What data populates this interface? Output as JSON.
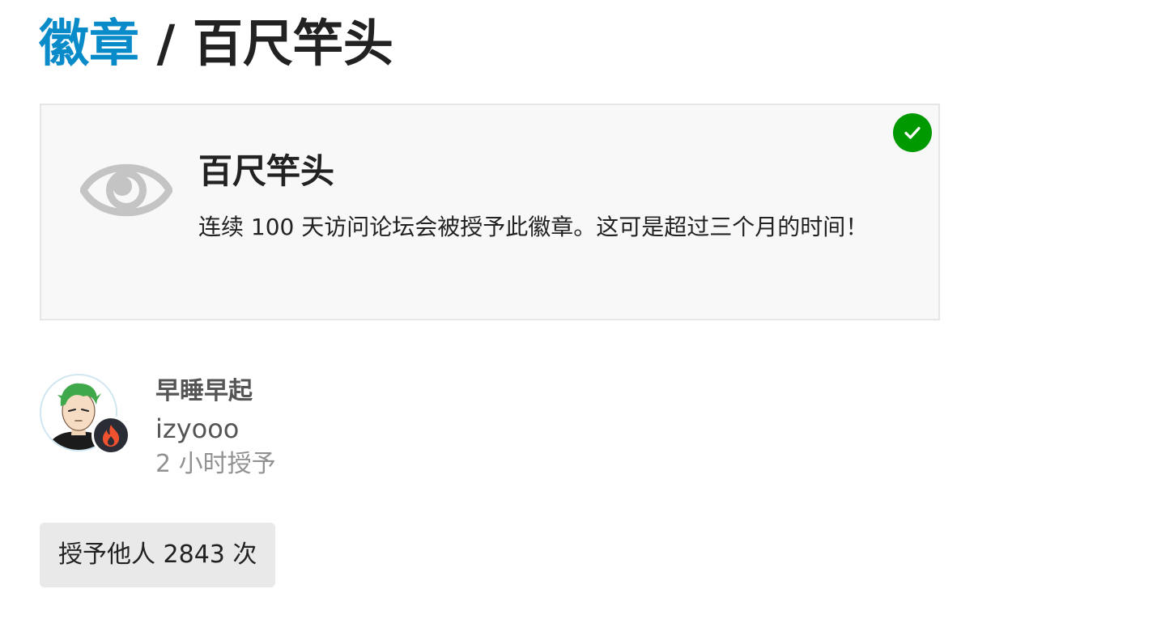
{
  "breadcrumb": {
    "parent_label": "徽章",
    "separator": "/",
    "current_label": "百尺竿头"
  },
  "badge": {
    "icon": "eye-icon",
    "name": "百尺竿头",
    "description": "连续 100 天访问论坛会被授予此徽章。这可是超过三个月的时间！",
    "granted": true,
    "granted_icon": "check-icon"
  },
  "recent_grant": {
    "display_name": "早睡早起",
    "username": "izyooo",
    "time_text": "2 小时授予",
    "flair_icon": "fire-icon"
  },
  "grant_count_button": {
    "label": "授予他人 2843 次"
  },
  "colors": {
    "link": "#0a8bc9",
    "success": "#009900",
    "card_bg": "#f8f8f8",
    "muted_text": "#919191",
    "button_bg": "#e9e9e9"
  }
}
